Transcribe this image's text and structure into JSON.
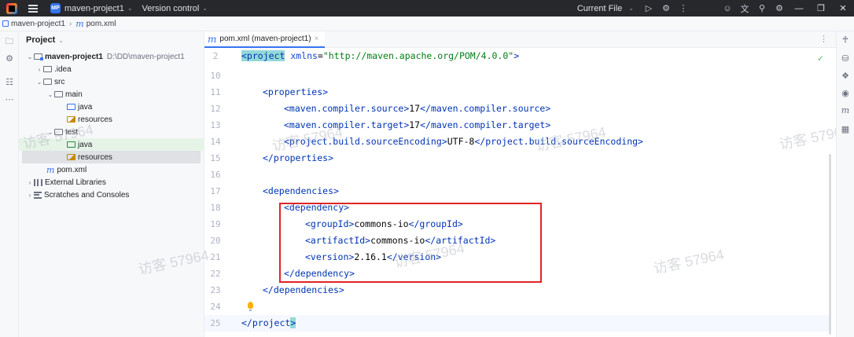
{
  "titlebar": {
    "project_badge": "MP",
    "project_name": "maven-project1",
    "vcs": "Version control",
    "run_config": "Current File",
    "icons": [
      "run-icon",
      "debug-icon",
      "more-vertical-icon",
      "user-icon",
      "translate-icon",
      "search-icon",
      "settings-icon"
    ],
    "window_controls": [
      "minimize",
      "restore",
      "close"
    ]
  },
  "breadcrumb": {
    "module": "maven-project1",
    "file": "pom.xml"
  },
  "project_panel": {
    "title": "Project",
    "tree": [
      {
        "label": "maven-project1",
        "path": "D:\\DD\\maven-project1"
      },
      {
        "label": ".idea"
      },
      {
        "label": "src"
      },
      {
        "label": "main"
      },
      {
        "label": "java"
      },
      {
        "label": "resources"
      },
      {
        "label": "test"
      },
      {
        "label": "java"
      },
      {
        "label": "resources"
      },
      {
        "label": "pom.xml"
      },
      {
        "label": "External Libraries"
      },
      {
        "label": "Scratches and Consoles"
      }
    ]
  },
  "editor": {
    "tab_label": "pom.xml (maven-project1)",
    "line_numbers": [
      "2",
      "10",
      "11",
      "12",
      "13",
      "14",
      "15",
      "16",
      "17",
      "18",
      "19",
      "20",
      "21",
      "22",
      "23",
      "24",
      "25"
    ],
    "code": {
      "l2_open": "<project",
      "l2_attr": " xmlns",
      "l2_eq": "=",
      "l2_val": "\"http://maven.apache.org/POM/4.0.0\"",
      "l2_close": ">",
      "l11": "<properties>",
      "l12_open": "<maven.compiler.source>",
      "l12_val": "17",
      "l12_close": "</maven.compiler.source>",
      "l13_open": "<maven.compiler.target>",
      "l13_val": "17",
      "l13_close": "</maven.compiler.target>",
      "l14_open": "<project.build.sourceEncoding>",
      "l14_val": "UTF-8",
      "l14_close": "</project.build.sourceEncoding>",
      "l15": "</properties>",
      "l17": "<dependencies>",
      "l18": "<dependency>",
      "l19_open": "<groupId>",
      "l19_val": "commons-io",
      "l19_close": "</groupId>",
      "l20_open": "<artifactId>",
      "l20_val": "commons-io",
      "l20_close": "</artifactId>",
      "l21_open": "<version>",
      "l21_val": "2.16.1",
      "l21_close": "</version>",
      "l22": "</dependency>",
      "l23": "</dependencies>",
      "l25_open": "</project",
      "l25_close": ">"
    }
  },
  "watermark": "访客 57964"
}
